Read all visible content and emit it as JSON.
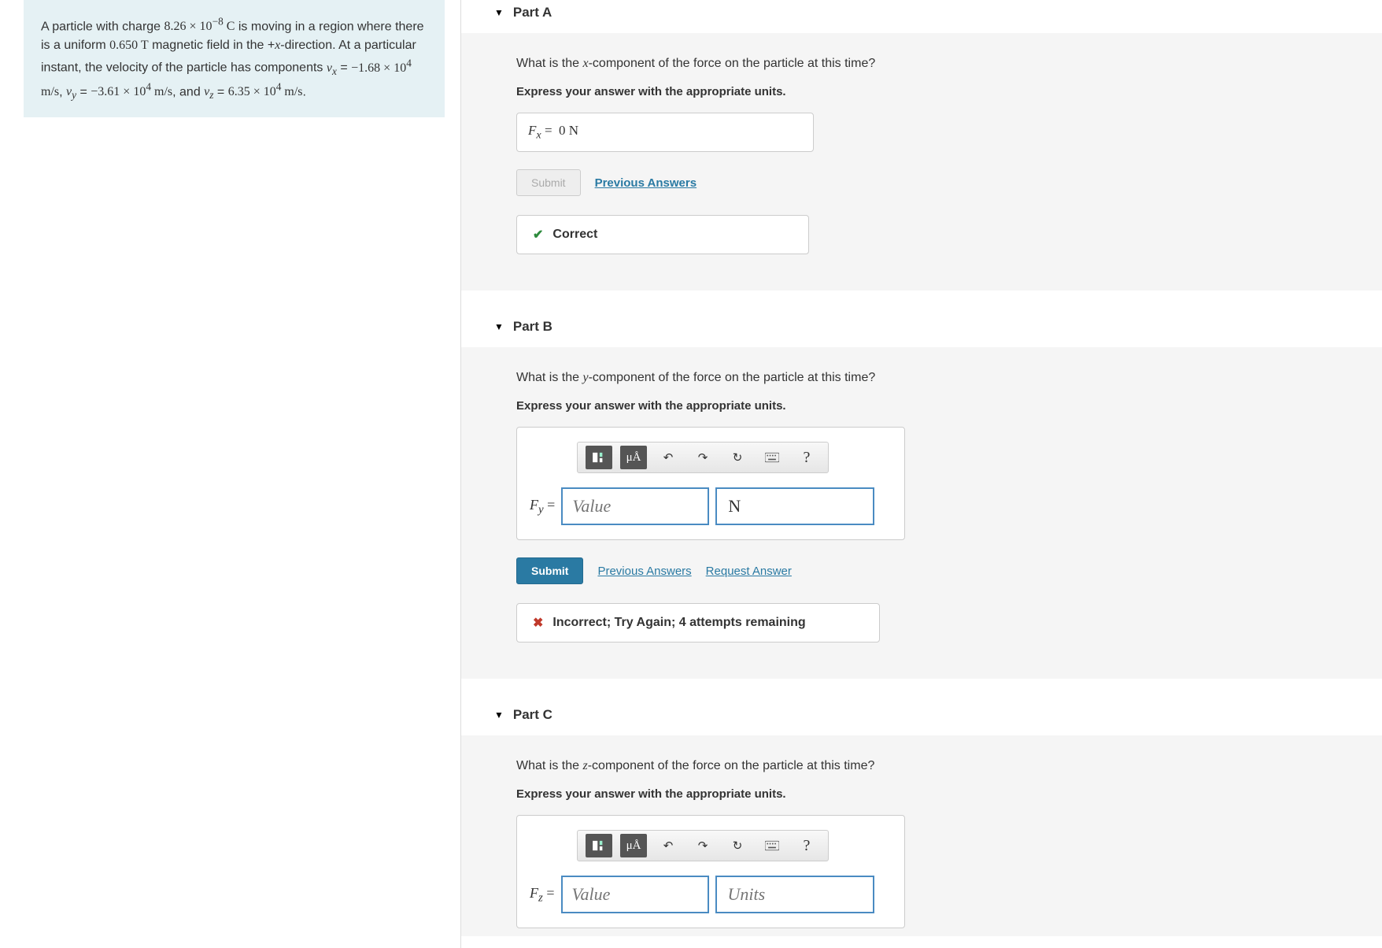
{
  "problem": {
    "html": "A particle with charge <span class='rm'>8.26 × 10<sup>−8</sup> C</span> is moving in a region where there is a uniform <span class='rm'>0.650 T</span> magnetic field in the +<i class='math'>x</i>-direction. At a particular instant, the velocity of the particle has components <i class='math'>v<sub>x</sub></i> = <span class='rm'>−1.68 × 10<sup>4</sup> m/s</span>, <i class='math'>v<sub>y</sub></i> = <span class='rm'>−3.61 × 10<sup>4</sup> m/s</span>, and <i class='math'>v<sub>z</sub></i> = <span class='rm'>6.35 × 10<sup>4</sup> m/s</span>."
  },
  "partA": {
    "title": "Part A",
    "question_html": "What is the <i class='math'>x</i>-component of the force on the particle at this time?",
    "instruction": "Express your answer with the appropriate units.",
    "answer_html": "<i class='math'>F<sub>x</sub></i> = &nbsp;0 N",
    "submit": "Submit",
    "prev": "Previous Answers",
    "feedback": "Correct"
  },
  "partB": {
    "title": "Part B",
    "question_html": "What is the <i class='math'>y</i>-component of the force on the particle at this time?",
    "instruction": "Express your answer with the appropriate units.",
    "var_html": "<i class='math'>F<sub>y</sub></i> =",
    "value_ph": "Value",
    "unit_val": "N",
    "submit": "Submit",
    "prev": "Previous Answers",
    "req": "Request Answer",
    "feedback": "Incorrect; Try Again; 4 attempts remaining",
    "tool_units": "μÅ"
  },
  "partC": {
    "title": "Part C",
    "question_html": "What is the <i class='math'>z</i>-component of the force on the particle at this time?",
    "instruction": "Express your answer with the appropriate units.",
    "var_html": "<i class='math'>F<sub>z</sub></i> =",
    "value_ph": "Value",
    "unit_ph": "Units",
    "tool_units": "μÅ"
  },
  "icons": {
    "help": "?"
  }
}
